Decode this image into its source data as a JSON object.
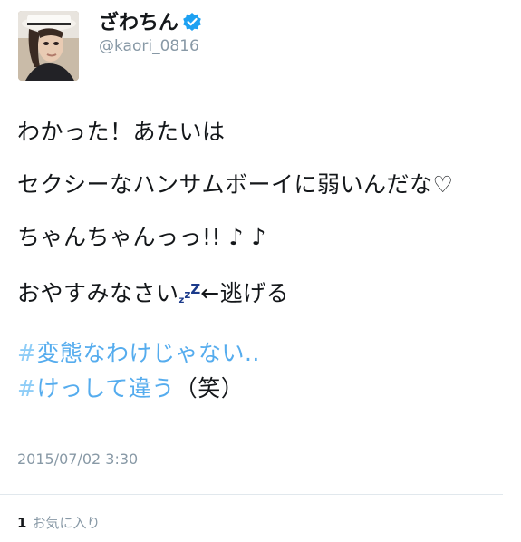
{
  "user": {
    "display_name": "ざわちん",
    "handle": "@kaori_0816",
    "verified_icon": "verified-badge-icon",
    "verified_color": "#1da1f2"
  },
  "tweet": {
    "line1": "わかった！あたいは",
    "line2": "セクシーなハンサムボーイに弱いんだな♡",
    "line3": "ちゃんちゃんっっ!! ♪ ♪",
    "line4_prefix": "おやすみなさい",
    "line4_zz": [
      "z",
      "z",
      "Z"
    ],
    "line4_suffix": "←逃げる",
    "hashtag1_symbol": "#",
    "hashtag1_text": "変態なわけじゃない..",
    "hashtag2_symbol": "#",
    "hashtag2_text": "けっして違う",
    "hashtag2_trailing": "（笑）"
  },
  "meta": {
    "timestamp": "2015/07/02 3:30",
    "favorite_count": "1",
    "favorite_label": "お気に入り"
  },
  "colors": {
    "link": "#55acee",
    "muted": "#8899a6",
    "text": "#14171a"
  }
}
